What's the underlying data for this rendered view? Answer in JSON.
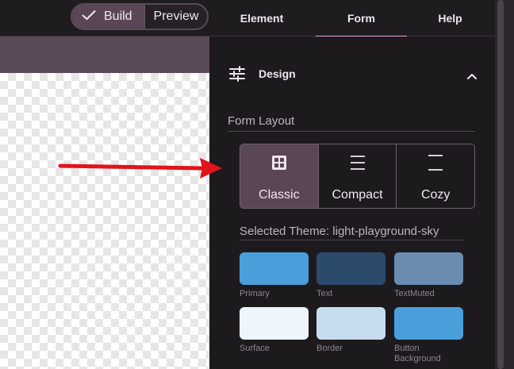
{
  "header": {
    "build_label": "Build",
    "preview_label": "Preview",
    "tabs": [
      {
        "label": "Element"
      },
      {
        "label": "Form",
        "active": true
      },
      {
        "label": "Help"
      }
    ],
    "accent_color": "#e6a4dc"
  },
  "design": {
    "title": "Design",
    "icon": "tune-icon",
    "expanded": true,
    "form_layout_label": "Form Layout",
    "layout_options": [
      {
        "label": "Classic",
        "icon": "grid-icon",
        "selected": true
      },
      {
        "label": "Compact",
        "icon": "compact-lines-icon",
        "selected": false
      },
      {
        "label": "Cozy",
        "icon": "cozy-lines-icon",
        "selected": false
      }
    ],
    "theme_label": "Selected Theme: light-playground-sky",
    "swatches": [
      {
        "label": "Primary",
        "color": "#4a9fdb"
      },
      {
        "label": "Text",
        "color": "#2c4a6b"
      },
      {
        "label": "TextMuted",
        "color": "#6a8cb0"
      },
      {
        "label": "Surface",
        "color": "#eef5fc"
      },
      {
        "label": "Border",
        "color": "#c8dcef"
      },
      {
        "label": "Button Background",
        "color": "#4a9fdb"
      }
    ]
  }
}
